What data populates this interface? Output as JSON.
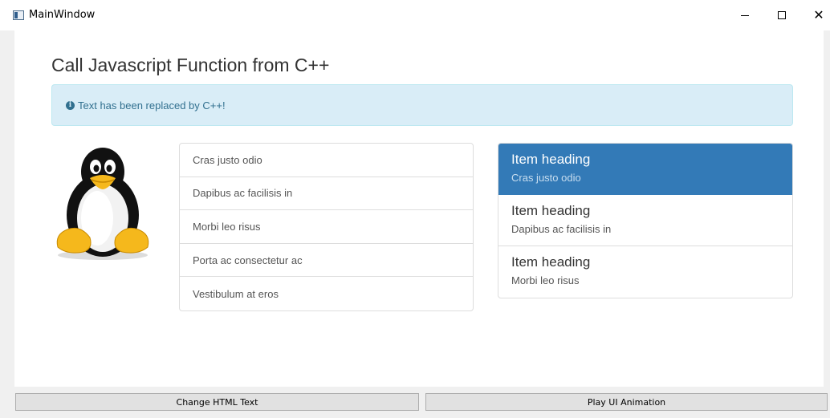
{
  "window": {
    "title": "MainWindow",
    "minimize_label": "Minimize",
    "maximize_label": "Maximize",
    "close_label": "Close"
  },
  "page": {
    "title": "Call Javascript Function from C++",
    "alert_text": "Text has been replaced by C++!",
    "alert_icon": "info-circle-icon",
    "image": "tux-penguin"
  },
  "list": {
    "items": [
      "Cras justo odio",
      "Dapibus ac facilisis in",
      "Morbi leo risus",
      "Porta ac consectetur ac",
      "Vestibulum at eros"
    ]
  },
  "cards": {
    "items": [
      {
        "heading": "Item heading",
        "text": "Cras justo odio",
        "active": true
      },
      {
        "heading": "Item heading",
        "text": "Dapibus ac facilisis in",
        "active": false
      },
      {
        "heading": "Item heading",
        "text": "Morbi leo risus",
        "active": false
      }
    ]
  },
  "buttons": {
    "change_html": "Change HTML Text",
    "play_animation": "Play UI Animation"
  },
  "colors": {
    "alert_bg": "#d9edf7",
    "alert_text": "#31708f",
    "active_bg": "#337ab7"
  }
}
